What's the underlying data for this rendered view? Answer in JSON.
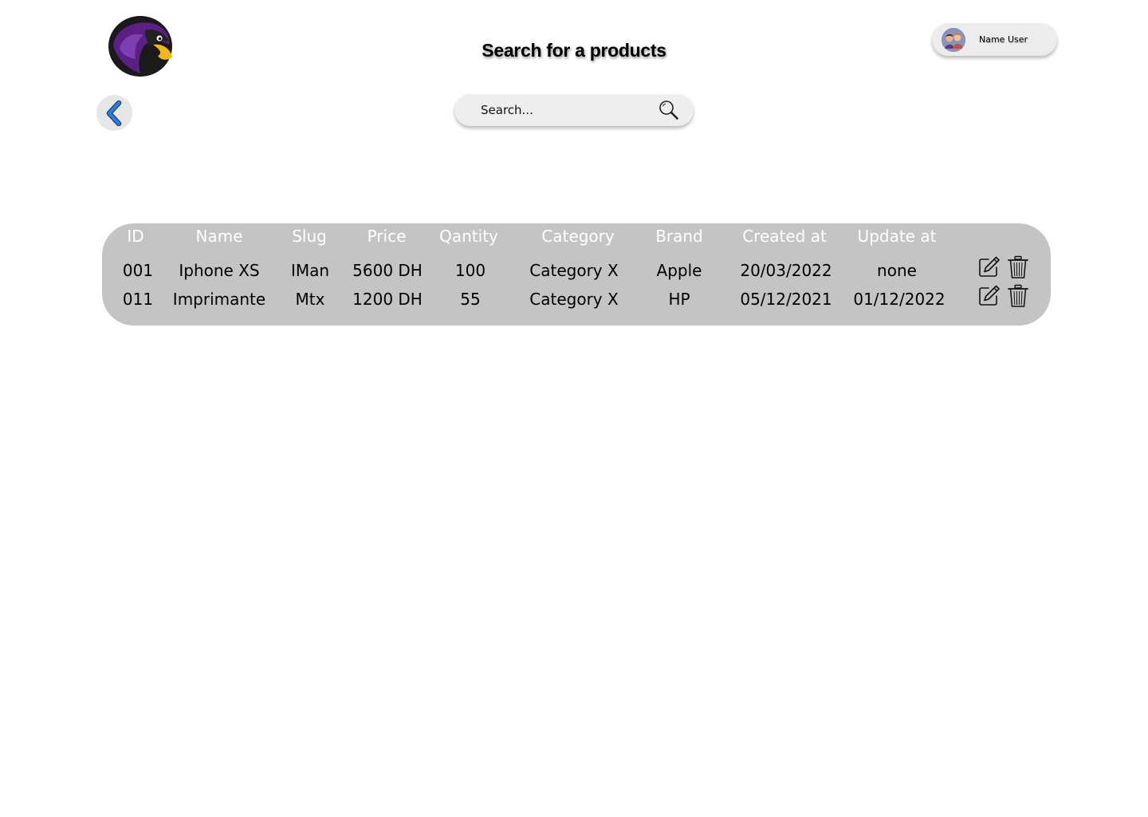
{
  "header": {
    "title": "Search for a products",
    "user_name": "Name User",
    "logo_icon": "eagle-logo-icon",
    "avatar_icon": "user-avatar-icon"
  },
  "nav": {
    "back_icon": "chevron-left-icon"
  },
  "search": {
    "placeholder": "Search...",
    "icon": "search-icon"
  },
  "table": {
    "columns": [
      "ID",
      "Name",
      "Slug",
      "Price",
      "Qantity",
      "Category",
      "Brand",
      "Created at",
      "Update at"
    ],
    "rows": [
      {
        "cells": [
          "001",
          "Iphone XS",
          "IMan",
          "5600 DH",
          "100",
          "Category X",
          "Apple",
          "20/03/2022",
          "none"
        ],
        "actions": [
          "edit-icon",
          "trash-icon"
        ]
      },
      {
        "cells": [
          "011",
          "Imprimante",
          "Mtx",
          "1200 DH",
          "55",
          "Category X",
          "HP",
          "05/12/2021",
          "01/12/2022"
        ],
        "actions": [
          "edit-icon",
          "trash-icon"
        ]
      }
    ]
  },
  "colors": {
    "table_background": "#c4c4c4",
    "header_text": "#ffffff",
    "accent_blue": "#2a7fd6",
    "logo_purple": "#5b1f86"
  }
}
